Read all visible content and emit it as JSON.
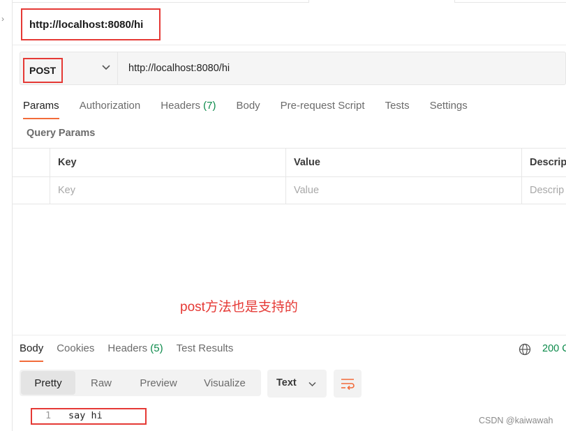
{
  "request": {
    "name": "http://localhost:8080/hi",
    "method": "POST",
    "url": "http://localhost:8080/hi"
  },
  "request_tabs": [
    {
      "label": "Params"
    },
    {
      "label": "Authorization"
    },
    {
      "label": "Headers",
      "count": "(7)"
    },
    {
      "label": "Body"
    },
    {
      "label": "Pre-request Script"
    },
    {
      "label": "Tests"
    },
    {
      "label": "Settings"
    }
  ],
  "active_request_tab": "Params",
  "query_params": {
    "title": "Query Params",
    "columns": [
      "Key",
      "Value",
      "Descrip"
    ],
    "placeholders": [
      "Key",
      "Value",
      "Descrip"
    ]
  },
  "annotation": "post方法也是支持的",
  "response_tabs": [
    {
      "label": "Body"
    },
    {
      "label": "Cookies"
    },
    {
      "label": "Headers",
      "count": "(5)"
    },
    {
      "label": "Test Results"
    }
  ],
  "active_response_tab": "Body",
  "status": "200 C",
  "view_modes": [
    "Pretty",
    "Raw",
    "Preview",
    "Visualize"
  ],
  "active_view_mode": "Pretty",
  "format": "Text",
  "response_lines": [
    {
      "num": "1",
      "text": "say hi"
    }
  ],
  "watermark": "CSDN @kaiwawah",
  "colors": {
    "accent": "#f26b3a",
    "highlight_box": "#e53935",
    "count_green": "#0b8a4a"
  },
  "icons": [
    "chevron-down-icon",
    "globe-icon",
    "wrap-lines-icon"
  ]
}
